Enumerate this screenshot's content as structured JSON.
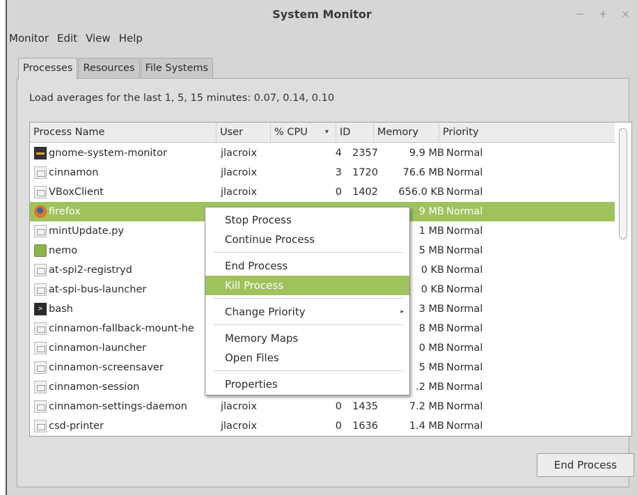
{
  "window": {
    "title": "System Monitor",
    "controls": {
      "minimize": "−",
      "maximize": "+",
      "close": "×"
    }
  },
  "menubar": [
    "Monitor",
    "Edit",
    "View",
    "Help"
  ],
  "tabs": [
    "Processes",
    "Resources",
    "File Systems"
  ],
  "load_averages": "Load averages for the last 1, 5, 15 minutes: 0.07, 0.14, 0.10",
  "columns": [
    "Process Name",
    "User",
    "% CPU",
    "ID",
    "Memory",
    "Priority"
  ],
  "sort_indicator": "▾",
  "processes": [
    {
      "name": "gnome-system-monitor",
      "icon": "system-monitor-icon",
      "user": "jlacroix",
      "cpu": "4",
      "id": "2357",
      "memory": "9.9 MB",
      "priority": "Normal"
    },
    {
      "name": "cinnamon",
      "icon": "executable-icon",
      "user": "jlacroix",
      "cpu": "3",
      "id": "1720",
      "memory": "76.6 MB",
      "priority": "Normal"
    },
    {
      "name": "VBoxClient",
      "icon": "executable-icon",
      "user": "jlacroix",
      "cpu": "0",
      "id": "1402",
      "memory": "656.0 KB",
      "priority": "Normal"
    },
    {
      "name": "firefox",
      "icon": "firefox-icon",
      "user": "",
      "cpu": "",
      "id": "",
      "memory": "9 MB",
      "priority": "Normal"
    },
    {
      "name": "mintUpdate.py",
      "icon": "executable-icon",
      "user": "",
      "cpu": "",
      "id": "",
      "memory": "1 MB",
      "priority": "Normal"
    },
    {
      "name": "nemo",
      "icon": "folder-icon",
      "user": "",
      "cpu": "",
      "id": "",
      "memory": "5 MB",
      "priority": "Normal"
    },
    {
      "name": "at-spi2-registryd",
      "icon": "executable-icon",
      "user": "",
      "cpu": "",
      "id": "",
      "memory": "0 KB",
      "priority": "Normal"
    },
    {
      "name": "at-spi-bus-launcher",
      "icon": "executable-icon",
      "user": "",
      "cpu": "",
      "id": "",
      "memory": "0 KB",
      "priority": "Normal"
    },
    {
      "name": "bash",
      "icon": "terminal-icon",
      "user": "",
      "cpu": "",
      "id": "",
      "memory": "3 MB",
      "priority": "Normal"
    },
    {
      "name": "cinnamon-fallback-mount-he",
      "icon": "executable-icon",
      "user": "",
      "cpu": "",
      "id": "",
      "memory": "8 MB",
      "priority": "Normal"
    },
    {
      "name": "cinnamon-launcher",
      "icon": "executable-icon",
      "user": "",
      "cpu": "",
      "id": "",
      "memory": "0 MB",
      "priority": "Normal"
    },
    {
      "name": "cinnamon-screensaver",
      "icon": "executable-icon",
      "user": "",
      "cpu": "",
      "id": "",
      "memory": "5 MB",
      "priority": "Normal"
    },
    {
      "name": "cinnamon-session",
      "icon": "executable-icon",
      "user": "",
      "cpu": "",
      "id": "",
      "memory": ".2 MB",
      "priority": "Normal"
    },
    {
      "name": "cinnamon-settings-daemon",
      "icon": "executable-icon",
      "user": "jlacroix",
      "cpu": "0",
      "id": "1435",
      "memory": "7.2 MB",
      "priority": "Normal"
    },
    {
      "name": "csd-printer",
      "icon": "executable-icon",
      "user": "jlacroix",
      "cpu": "0",
      "id": "1636",
      "memory": "1.4 MB",
      "priority": "Normal"
    }
  ],
  "selected_process": "firefox",
  "context_menu": {
    "items": [
      "Stop Process",
      "Continue Process",
      "End Process",
      "Kill Process",
      "Change Priority",
      "Memory Maps",
      "Open Files",
      "Properties"
    ],
    "highlighted": "Kill Process",
    "submenu_arrow": "▸"
  },
  "end_process_button": "End Process",
  "colors": {
    "selection": "#9fc25c",
    "window_bg": "#d6d6d6",
    "list_bg": "#ffffff"
  }
}
